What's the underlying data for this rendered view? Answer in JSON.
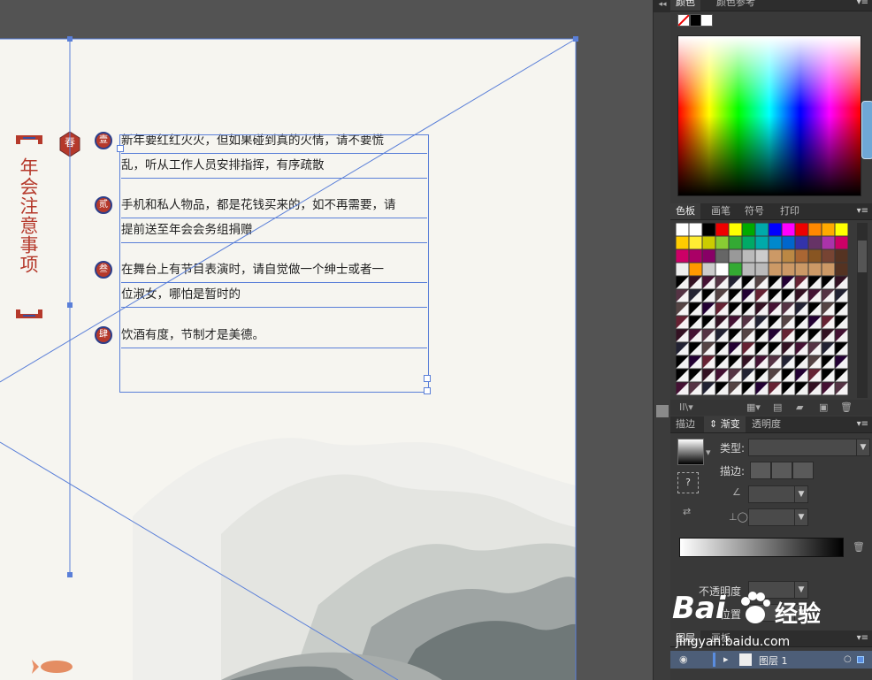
{
  "poster": {
    "vertical_title": "年会注意事项",
    "spring_char": "春",
    "notes": [
      {
        "num": "壹",
        "lines": [
          "新年要红红火火，但如果碰到真的火情，请不要慌",
          "乱，听从工作人员安排指挥，有序疏散"
        ]
      },
      {
        "num": "贰",
        "lines": [
          "手机和私人物品，都是花钱买来的，如不再需要，请",
          "提前送至年会会务组捐赠"
        ]
      },
      {
        "num": "叁",
        "lines": [
          "在舞台上有节目表演时，请自觉做一个绅士或者一",
          "位淑女，哪怕是暂时的"
        ]
      },
      {
        "num": "肆",
        "lines": [
          "饮酒有度，节制才是美德。"
        ]
      }
    ]
  },
  "panels": {
    "color": {
      "tabs": [
        "颜色",
        "颜色参考"
      ]
    },
    "swatches": {
      "tabs": [
        "色板",
        "画笔",
        "符号",
        "打印"
      ]
    },
    "gradient": {
      "tabs": [
        "描边",
        "渐变",
        "透明度"
      ],
      "type_label": "类型:",
      "stroke_label": "描边:",
      "opacity_label": "不透明度",
      "position_label": "位置"
    },
    "layers": {
      "tabs": [
        "图层",
        "画板"
      ],
      "layer_name": "图层 1"
    }
  },
  "watermark": {
    "brand": "Bai",
    "brand_cn": "经验",
    "url": "jingyan.baidu.com"
  },
  "colors": {
    "accent_red": "#b5392b",
    "guide_blue": "#5a7fd8",
    "panel_bg": "#393939"
  }
}
